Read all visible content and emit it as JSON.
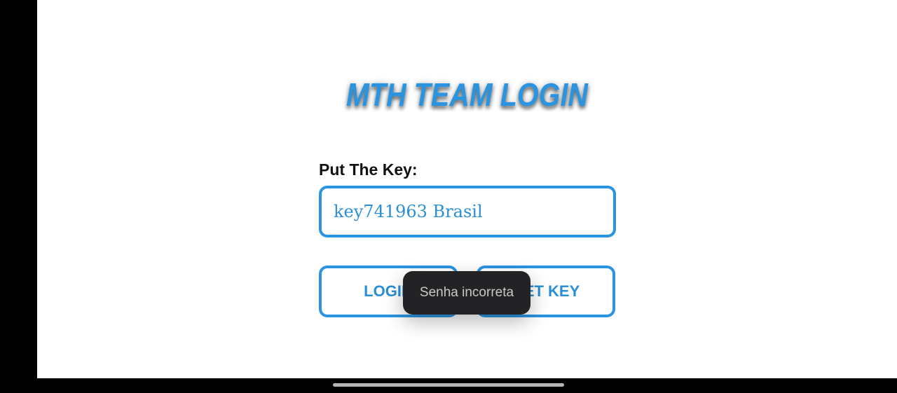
{
  "app": {
    "title": "MTH TEAM LOGIN",
    "key_label": "Put The Key:",
    "key_input_value": "key741963 Brasil",
    "buttons": {
      "login": "LOGIN",
      "get_key": "GET KEY"
    },
    "toast": "Senha incorreta"
  },
  "colors": {
    "accent": "#2b94e1",
    "toast_bg": "#232325",
    "toast_text": "#c8c8c8",
    "background": "#ffffff"
  },
  "icons": {
    "home_handle": "home-gesture-bar"
  }
}
